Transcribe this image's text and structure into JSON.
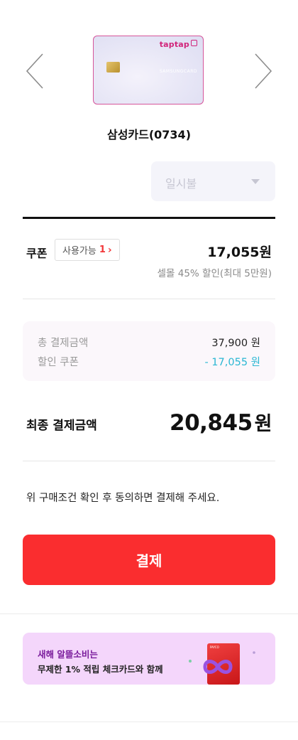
{
  "card": {
    "brand": "taptap",
    "issuer": "SAMSUNGCARD",
    "name": "삼성카드(0734)"
  },
  "installment": {
    "value": "일시불"
  },
  "coupon": {
    "label": "쿠폰",
    "available_label": "사용가능",
    "available_count": "1",
    "amount": "17,055원",
    "description": "셀몰 45% 할인(최대 5만원)"
  },
  "summary": {
    "total_label": "총 결제금액",
    "total_value": "37,900 원",
    "discount_label": "할인 쿠폰",
    "discount_value": "- 17,055 원"
  },
  "final": {
    "label": "최종 결제금액",
    "amount": "20,845",
    "unit": "원"
  },
  "notice": "위 구매조건 확인 후 동의하면 결제해 주세요.",
  "pay_button": "결제",
  "banner": {
    "title": "새해 알뜰소비는",
    "subtitle": "무제한 1% 적립 체크카드와 함께",
    "card_brand": "PAYCO"
  },
  "colors": {
    "accent": "#fa2d2f",
    "discount": "#2ab7d3",
    "card_border": "#d6559a",
    "banner_bg": "#f4d6fb"
  }
}
